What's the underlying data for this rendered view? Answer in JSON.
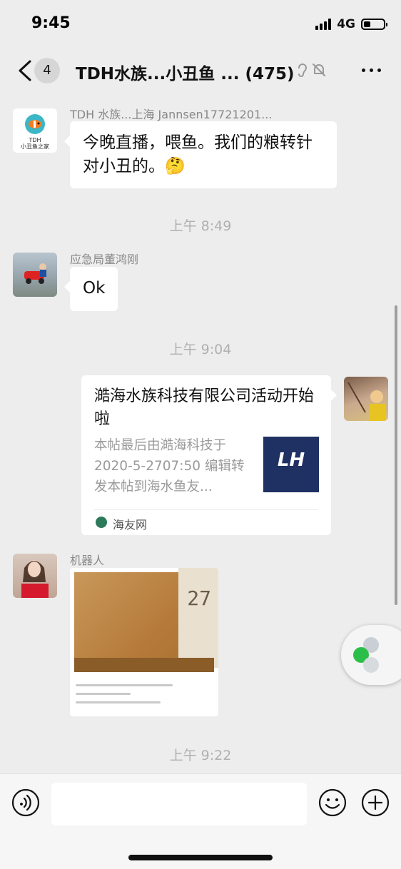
{
  "status_bar": {
    "time": "9:45",
    "network": "4G",
    "battery_level": 0.35
  },
  "header": {
    "unread_count": "4",
    "title": "TDH水族...小丑鱼 ...",
    "member_count": "(475)"
  },
  "messages": [
    {
      "sender": "TDH 水族...上海 Jannsen17721201...",
      "text": "今晚直播，喂鱼。我们的粮转针对小丑的。🤔",
      "avatar_text": "TDH\n小丑鱼之家"
    },
    {
      "timestamp": "上午 8:49"
    },
    {
      "sender": "应急局董鸿刚",
      "text": "Ok"
    },
    {
      "timestamp": "上午 9:04"
    },
    {
      "link": {
        "title": "澔海水族科技有限公司活动开始啦",
        "description": "本帖最后由澔海科技于2020-5-2707:50 编辑转发本帖到海水鱼友...",
        "source": "海友网",
        "thumb_text": "LH"
      }
    },
    {
      "sender": "机器人",
      "image": {
        "date_text": "27"
      }
    },
    {
      "timestamp": "上午 9:22"
    }
  ],
  "input": {
    "placeholder": ""
  },
  "colors": {
    "background": "#ededed",
    "bubble": "#ffffff",
    "thumb_brand": "#1f3063",
    "widget_green": "#2bbf4a"
  }
}
